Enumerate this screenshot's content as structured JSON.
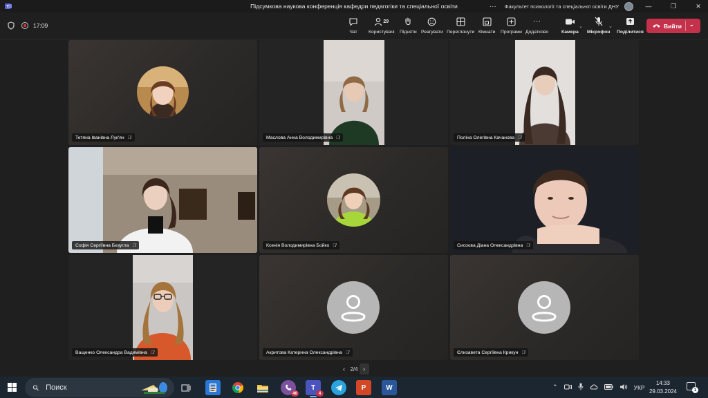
{
  "window": {
    "title": "Підсумкова наукова конференція кафедри педагогіки та спеціальної освіти",
    "org_name": "Факультет психології та спеціальної освіти ДНУ",
    "more_label": "···",
    "minimize": "—",
    "restore": "❐",
    "close": "✕"
  },
  "toolbar": {
    "timer": "17:09",
    "chat_label": "Чат",
    "people_label": "Користувачі",
    "people_count": "29",
    "raise_label": "Підняти",
    "react_label": "Реагувати",
    "view_label": "Переглянути",
    "rooms_label": "Кімнати",
    "apps_label": "Програми",
    "more_label": "Додатково",
    "camera_label": "Камера",
    "mic_label": "Мікрофон",
    "share_label": "Поділитися",
    "leave_label": "Вийти"
  },
  "participants": [
    {
      "name": "Тетяна Іванівна Лук'ян",
      "type": "avatar"
    },
    {
      "name": "Маслова Анна Володимирівна",
      "type": "video"
    },
    {
      "name": "Поліна Олегівна Качанова",
      "type": "video"
    },
    {
      "name": "Софія Сергіївна Безугла",
      "type": "video"
    },
    {
      "name": "Ксенія Володимирівна Бойко",
      "type": "avatar"
    },
    {
      "name": "Сисоєва Діана Олександрівна",
      "type": "video"
    },
    {
      "name": "Ващенко Олександра Вадимівна",
      "type": "video"
    },
    {
      "name": "Акритова Катерина Олександрівна",
      "type": "placeholder"
    },
    {
      "name": "Єлизавета Сергіївна Крикун",
      "type": "placeholder"
    }
  ],
  "pager": {
    "label": "2/4",
    "prev": "‹",
    "next": "›"
  },
  "taskbar": {
    "search_placeholder": "Поиск",
    "viber_badge": "46",
    "teams_badge": "4",
    "language": "УКР",
    "time": "14:33",
    "date": "29.03.2024",
    "notification_count": "1"
  },
  "colors": {
    "leave": "#c4314b",
    "taskbar": "#1c2630",
    "stage": "#1f1f1f"
  }
}
